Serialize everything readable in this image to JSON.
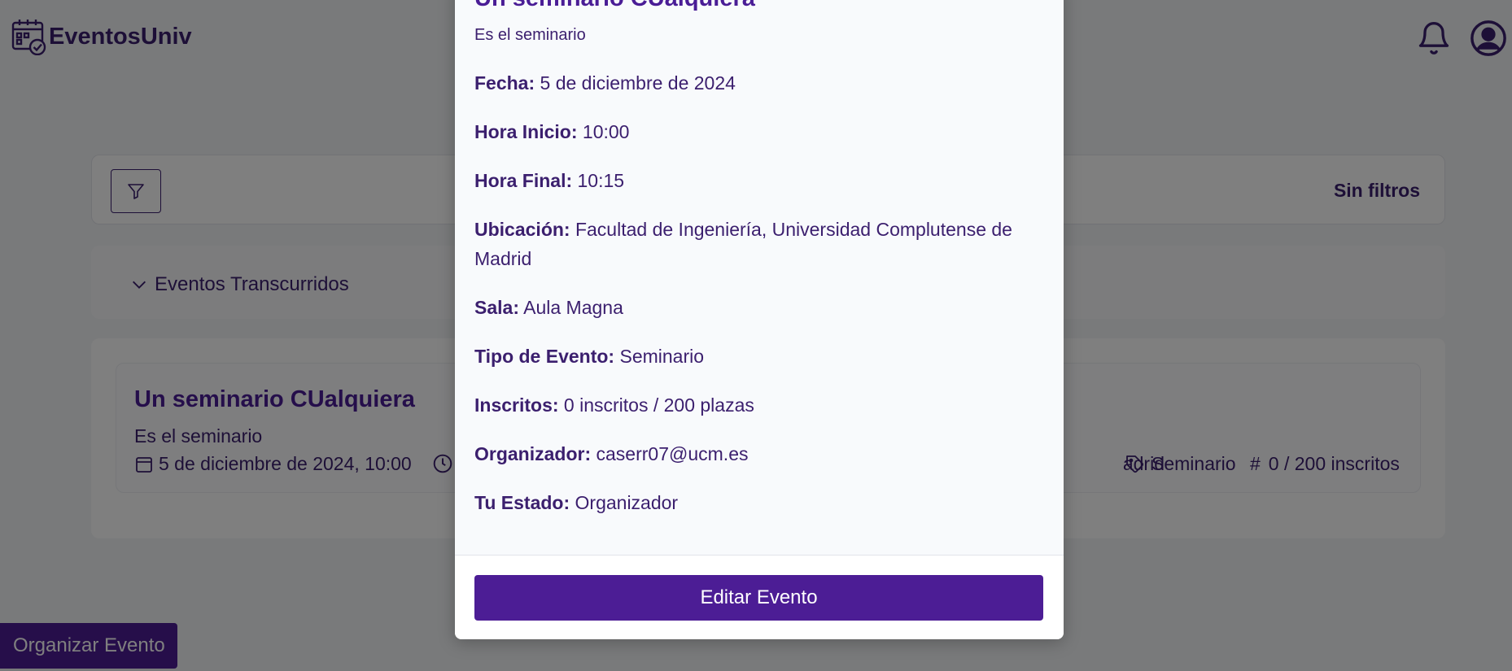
{
  "header": {
    "brand": "EventosUniv",
    "icons": {
      "logo": "calendar-check-icon",
      "notifications": "bell-icon",
      "user": "user-circle-icon"
    }
  },
  "filters": {
    "button_icon": "filter-icon",
    "status": "Sin filtros"
  },
  "past_events": {
    "label": "Eventos Transcurridos"
  },
  "event_card": {
    "title": "Un seminario CUalquiera",
    "description": "Es el seminario",
    "date": "5 de diciembre de 2024, 10:00",
    "location_partial": "adrid",
    "type": "Seminario",
    "count_symbol": "#",
    "count": "0 / 200 inscritos"
  },
  "organize_button": "Organizar Evento",
  "modal": {
    "title": "Un seminario CUalquiera",
    "subtitle": "Es el seminario",
    "details": [
      {
        "label": "Fecha:",
        "value": "5 de diciembre de 2024"
      },
      {
        "label": "Hora Inicio:",
        "value": "10:00"
      },
      {
        "label": "Hora Final:",
        "value": "10:15"
      },
      {
        "label": "Ubicación:",
        "value": "Facultad de Ingeniería, Universidad Complutense de Madrid"
      },
      {
        "label": "Sala:",
        "value": "Aula Magna"
      },
      {
        "label": "Tipo de Evento:",
        "value": "Seminario"
      },
      {
        "label": "Inscritos:",
        "value": "0 inscritos / 200 plazas"
      },
      {
        "label": "Organizador:",
        "value": "caserr07@ucm.es"
      },
      {
        "label": "Tu Estado:",
        "value": "Organizador"
      }
    ],
    "edit_button": "Editar Evento"
  },
  "colors": {
    "primary": "#4c1d95",
    "text": "#3b1f6e",
    "overlay": "rgba(0,0,0,0.5)"
  }
}
